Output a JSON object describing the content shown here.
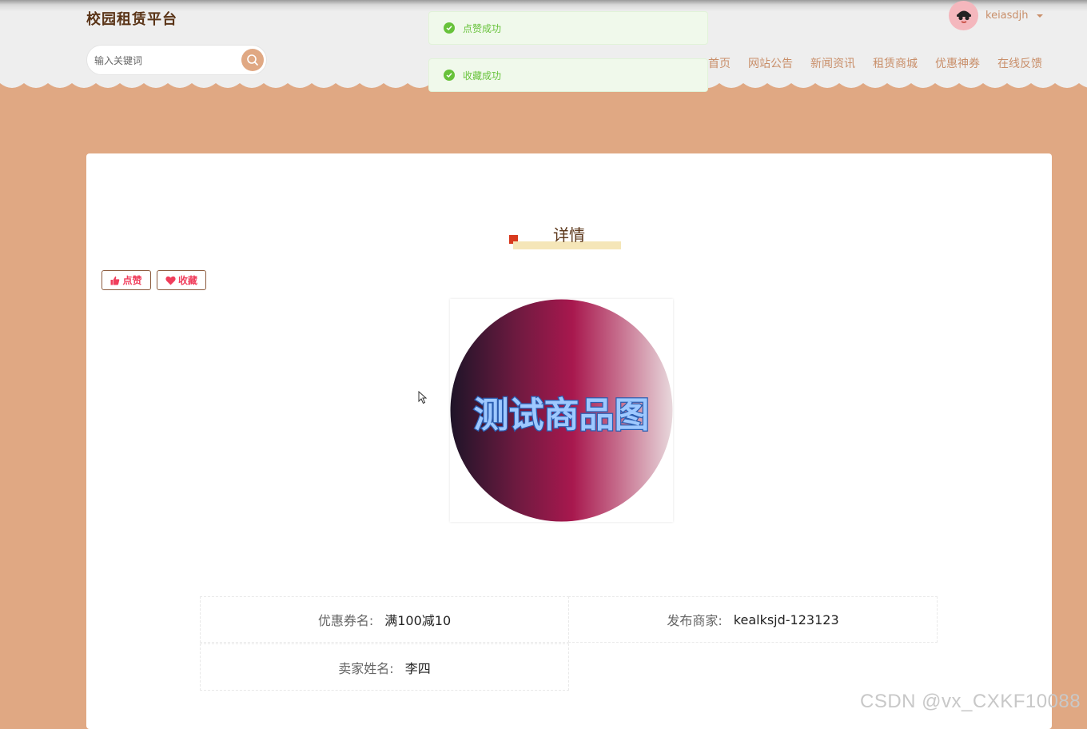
{
  "header": {
    "site_title": "校园租赁平台",
    "search_placeholder": "输入关键词",
    "nav": [
      "首页",
      "网站公告",
      "新闻资讯",
      "租赁商城",
      "优惠神券",
      "在线反馈"
    ],
    "username": "keiasdjh"
  },
  "toasts": [
    "点赞成功",
    "收藏成功"
  ],
  "detail": {
    "title": "详情",
    "like_label": "点赞",
    "collect_label": "收藏",
    "image_text": "测试商品图"
  },
  "info": {
    "coupon_name_label": "优惠券名:",
    "coupon_name_value": "满100减10",
    "merchant_label": "发布商家:",
    "merchant_value": "kealksjd-123123",
    "seller_name_label": "卖家姓名:",
    "seller_name_value": "李四"
  },
  "watermark": "CSDN @vx_CXKF10088",
  "colors": {
    "primary": "#e0a883",
    "title_brown": "#5a3417",
    "nav_text": "#c98f6a",
    "success": "#67c23a",
    "button_pink": "#f03e5c"
  }
}
